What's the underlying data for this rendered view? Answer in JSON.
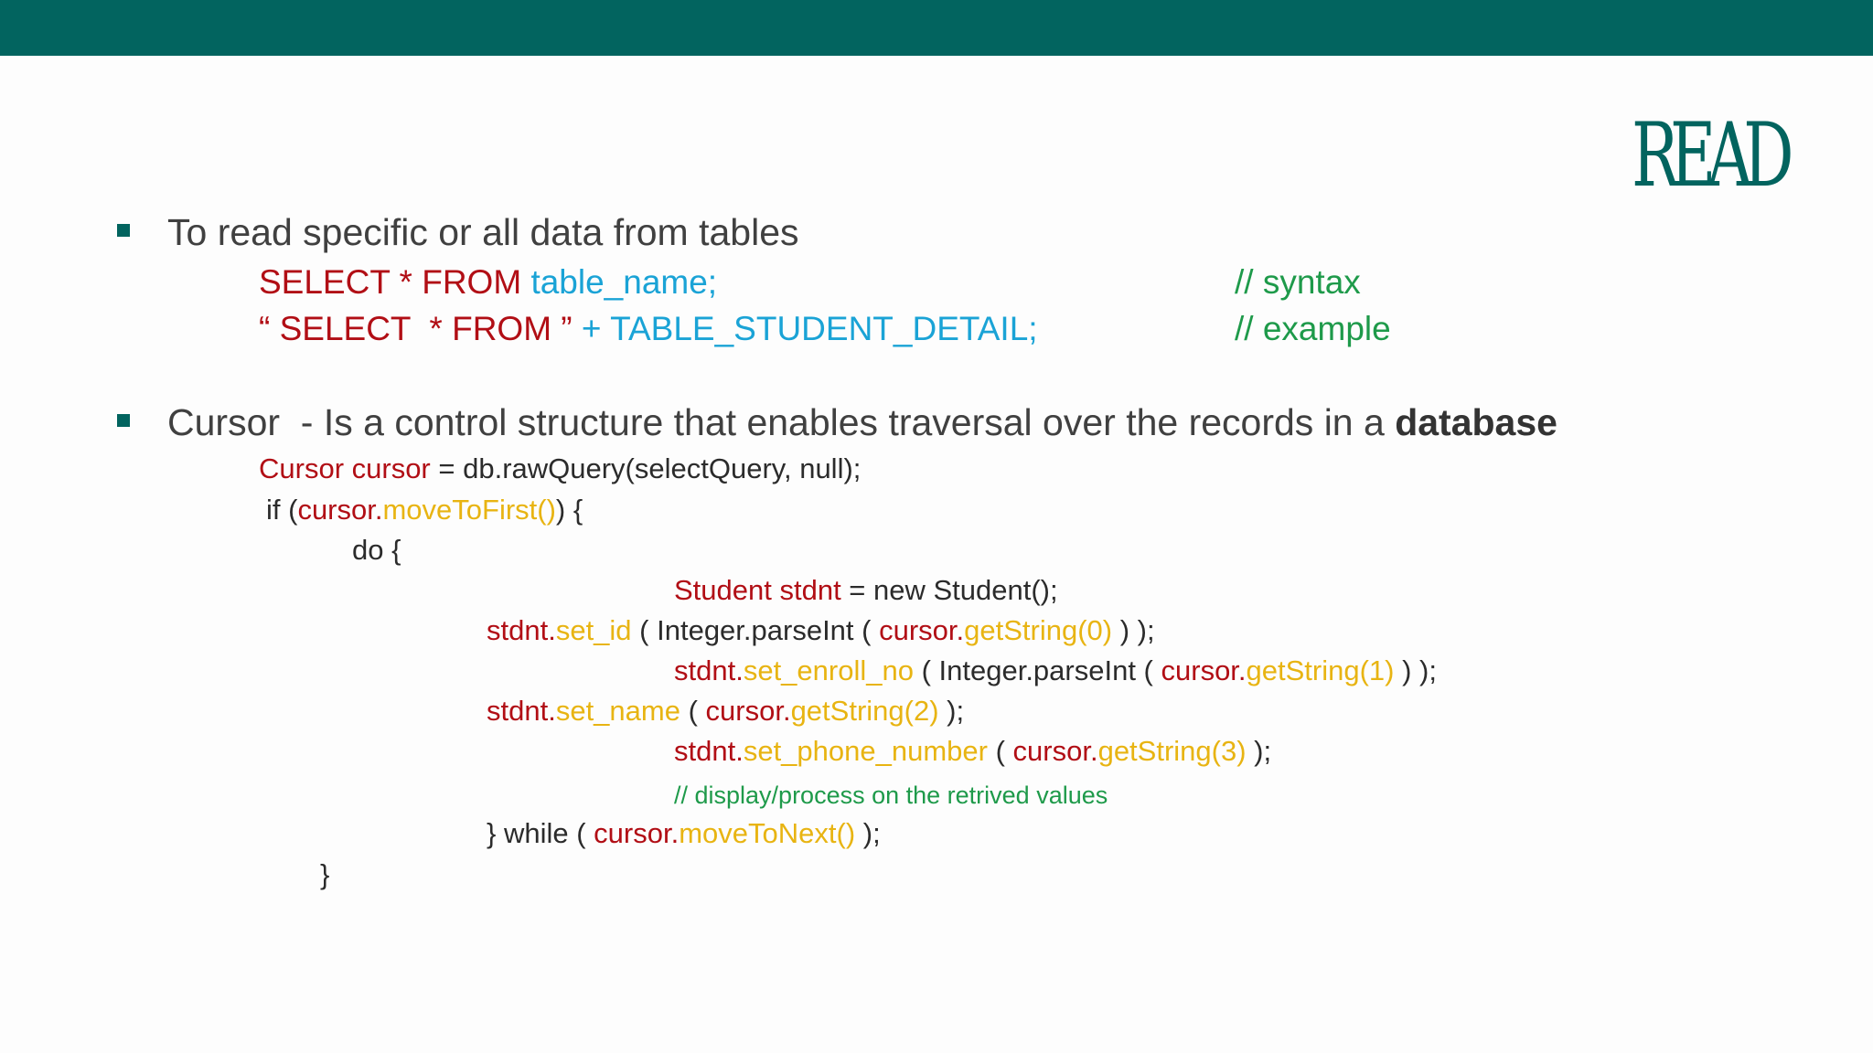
{
  "slide": {
    "title": "READ",
    "bullet1": {
      "text": "To read specific or all data from tables",
      "syntax_line": {
        "keyword": "SELECT * FROM",
        "table": "table_name;",
        "comment": "// syntax"
      },
      "example_line": {
        "keyword": "“ SELECT  * FROM ”",
        "rest": "+ TABLE_STUDENT_DETAIL;",
        "comment": "// example"
      }
    },
    "bullet2": {
      "lead": "Cursor  - Is a control structure that enables traversal over the records in a ",
      "bold": "database"
    },
    "code": {
      "l1_type": "Cursor cursor",
      "l1_rest": " = db.rawQuery(selectQuery, null);",
      "l2_a": "if (",
      "l2_cursor": "cursor.",
      "l2_method": "moveToFirst()",
      "l2_end": ") {",
      "l3": "do {",
      "l4_type": "Student stdnt",
      "l4_rest": " = new Student();",
      "l5_obj": "stdnt.",
      "l5_method": "set_id",
      "l5_mid": " ( Integer.parseInt ( ",
      "l5_cursor": "cursor.",
      "l5_get": "getString(0)",
      "l5_end": " ) );",
      "l6_obj": "stdnt.",
      "l6_method": "set_enroll_no",
      "l6_mid": " ( Integer.parseInt ( ",
      "l6_cursor": "cursor.",
      "l6_get": "getString(1)",
      "l6_end": " ) );",
      "l7_obj": "stdnt.",
      "l7_method": "set_name",
      "l7_mid": " ( ",
      "l7_cursor": "cursor.",
      "l7_get": "getString(2)",
      "l7_end": " );",
      "l8_obj": "stdnt.",
      "l8_method": "set_phone_number",
      "l8_mid": " ( ",
      "l8_cursor": "cursor.",
      "l8_get": "getString(3)",
      "l8_end": " );",
      "l9_comment": "// display/process on the retrived values",
      "l10_a": "} while ( ",
      "l10_cursor": "cursor.",
      "l10_method": "moveToNext()",
      "l10_end": " );",
      "l11": "}"
    }
  },
  "colors": {
    "header_bar": "#02645f",
    "keyword_red": "#b10e15",
    "identifier_blue": "#1aa3d6",
    "comment_green": "#1e9a4a",
    "method_gold": "#e8b412"
  }
}
